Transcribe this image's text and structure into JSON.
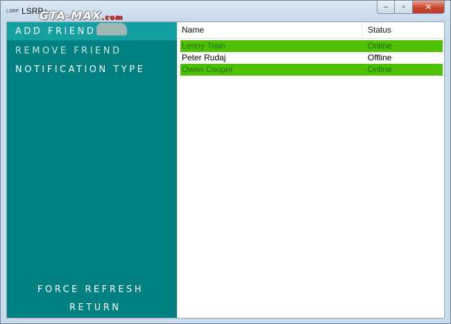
{
  "window": {
    "title": "LSRP+",
    "icon_text": "LSRP",
    "close_glyph": "✕",
    "maximize_glyph": "▫",
    "minimize_glyph": "–"
  },
  "watermark": {
    "text": "GTA-MAX",
    "suffix": ".com"
  },
  "sidebar": {
    "items": [
      {
        "label": "ADD FRIEND",
        "selected": true
      },
      {
        "label": "REMOVE FRIEND"
      },
      {
        "label": "NOTIFICATION TYPE"
      }
    ],
    "bottom_items": [
      {
        "label": "FORCE REFRESH"
      },
      {
        "label": "RETURN"
      }
    ]
  },
  "friends_list": {
    "columns": [
      "Name",
      "Status"
    ],
    "rows": [
      {
        "name": "Lenny Train",
        "status": "Online"
      },
      {
        "name": "Peter Rudaj",
        "status": "Offline"
      },
      {
        "name": "Owen Cooper",
        "status": "Online"
      }
    ]
  },
  "colors": {
    "sidebar_bg": "#008080",
    "sidebar_selected_bg": "#14a0a0",
    "online_row_bg": "#4fc000",
    "online_row_text": "#1e6e10",
    "offline_row_text": "#000000"
  }
}
